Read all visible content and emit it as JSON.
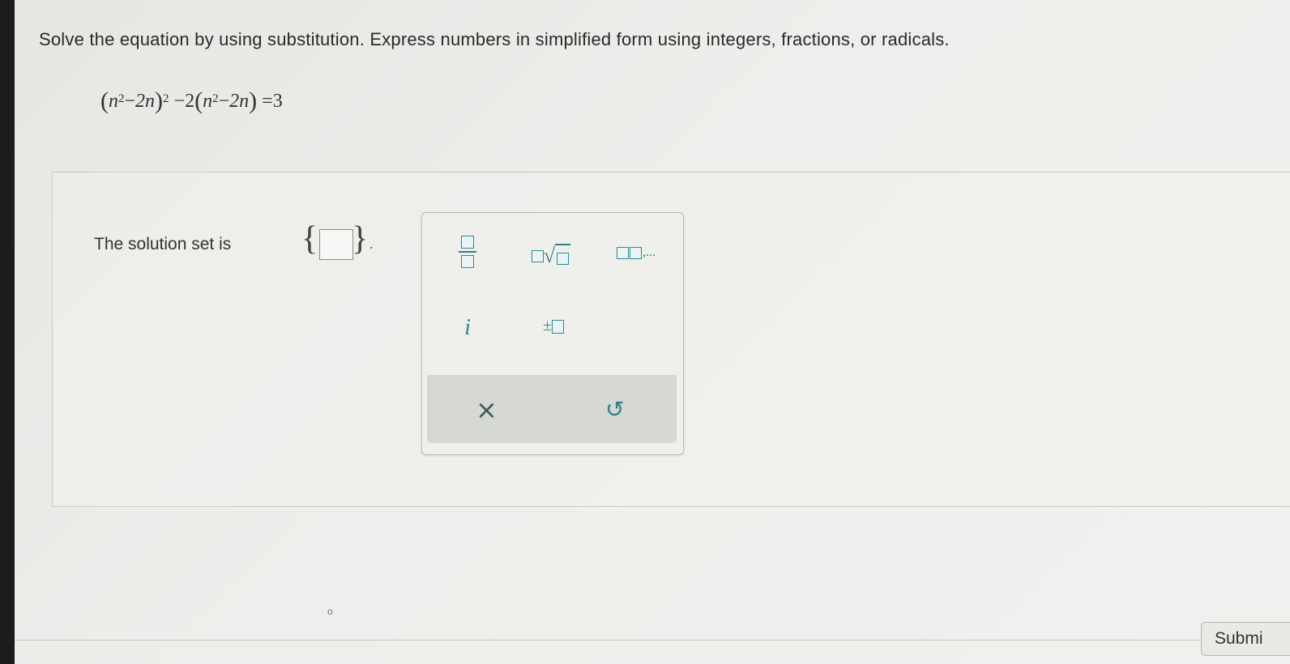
{
  "question": {
    "instructions": "Solve the equation by using substitution. Express numbers in simplified form using integers, fractions, or radicals.",
    "equation": {
      "base": "n",
      "exponent": "2",
      "linear_term": "2n",
      "outer_exponent": "2",
      "coefficient": "2",
      "rhs": "3"
    }
  },
  "answer": {
    "prompt": "The solution set is",
    "input_value": ""
  },
  "palette": {
    "fraction_label": "fraction",
    "nth_root_label": "nth root",
    "list_ellipsis": ",...",
    "imaginary_unit": "i",
    "plus_minus": "±",
    "clear": "×",
    "undo": "↺"
  },
  "footer": {
    "submit_label": "Submi"
  },
  "colors": {
    "accent": "#2f7f8a",
    "page_bg": "#eeefec"
  }
}
